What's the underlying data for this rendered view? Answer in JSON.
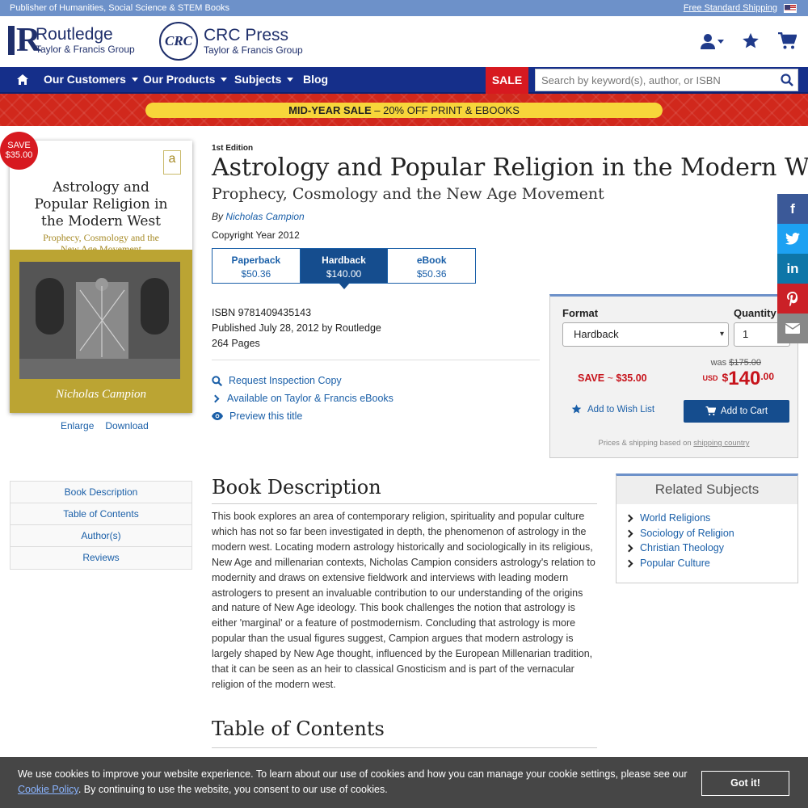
{
  "topbar": {
    "tagline": "Publisher of Humanities, Social Science & STEM Books",
    "shipping_link": "Free Standard Shipping",
    "flag_icon": "us-flag-icon"
  },
  "logos": {
    "routledge": {
      "name": "Routledge",
      "group": "Taylor & Francis Group"
    },
    "crc": {
      "mark": "CRC",
      "name": "CRC Press",
      "group": "Taylor & Francis Group"
    }
  },
  "header_icons": [
    "user-icon",
    "star-icon",
    "cart-icon"
  ],
  "nav": {
    "home_icon": "home-icon",
    "items": [
      "Our Customers",
      "Our Products",
      "Subjects",
      "Blog"
    ],
    "sale": "SALE",
    "search_placeholder": "Search by keyword(s), author, or ISBN"
  },
  "promo": {
    "bold": "MID-YEAR SALE",
    "rest": " – 20% OFF PRINT & EBOOKS"
  },
  "cover": {
    "title": "Astrology and Popular Religion in the Modern West",
    "subtitle": "Prophecy, Cosmology and the New Age Movement",
    "author": "Nicholas Campion",
    "badge_line1": "SAVE",
    "badge_line2": "$35.00",
    "enlarge": "Enlarge",
    "download": "Download"
  },
  "book": {
    "edition": "1st Edition",
    "title": "Astrology and Popular Religion in the Modern West",
    "subtitle": "Prophecy, Cosmology and the New Age Movement",
    "by": "By ",
    "author": "Nicholas Campion",
    "copyright": "Copyright Year 2012",
    "formats": [
      {
        "name": "Paperback",
        "price": "$50.36"
      },
      {
        "name": "Hardback",
        "price": "$140.00"
      },
      {
        "name": "eBook",
        "price": "$50.36"
      }
    ],
    "isbn": "ISBN 9781409435143",
    "published": "Published July 28, 2012 by Routledge",
    "pages": "264 Pages",
    "actions": [
      {
        "label": "Request Inspection Copy",
        "icon": "search-icon"
      },
      {
        "label": "Available on Taylor & Francis eBooks",
        "icon": "chevron-right-icon"
      },
      {
        "label": "Preview this title",
        "icon": "eye-icon"
      }
    ]
  },
  "buybox": {
    "format_label": "Format",
    "quantity_label": "Quantity",
    "format_value": "Hardback",
    "quantity_value": "1",
    "was_label": "was ",
    "was_price": "$175.00",
    "save_label": "SAVE",
    "save_sep": " ~ ",
    "save_amount": "$35.00",
    "currency": "USD",
    "price_symbol": "$",
    "price_whole": "140",
    "price_cents": ".00",
    "wish_label": "Add to Wish List",
    "cart_label": "Add to Cart",
    "ship_note": "Prices & shipping based on ",
    "ship_link": "shipping country"
  },
  "social": [
    {
      "icon": "facebook-icon",
      "glyph": "f",
      "color": "#3b5998"
    },
    {
      "icon": "twitter-icon",
      "glyph": "t",
      "color": "#1da1f2"
    },
    {
      "icon": "linkedin-icon",
      "glyph": "in",
      "color": "#0e76a8"
    },
    {
      "icon": "pinterest-icon",
      "glyph": "p",
      "color": "#cb2027"
    },
    {
      "icon": "email-icon",
      "glyph": "✉",
      "color": "#888888"
    }
  ],
  "side_nav": [
    "Book Description",
    "Table of Contents",
    "Author(s)",
    "Reviews"
  ],
  "description": {
    "heading": "Book Description",
    "text": "This book explores an area of contemporary religion, spirituality and popular culture which has not so far been investigated in depth, the phenomenon of astrology in the modern west. Locating modern astrology historically and sociologically in its religious, New Age and millenarian contexts, Nicholas Campion considers astrology's relation to modernity and draws on extensive fieldwork and interviews with leading modern astrologers to present an invaluable contribution to our understanding of the origins and nature of New Age ideology. This book challenges the notion that astrology is either 'marginal' or a feature of postmodernism. Concluding that astrology is more popular than the usual figures suggest, Campion argues that modern astrology is largely shaped by New Age thought, influenced by the European Millenarian tradition, that it can be seen as an heir to classical Gnosticism and is part of the vernacular religion of the modern west."
  },
  "toc": {
    "heading": "Table of Contents"
  },
  "related": {
    "heading": "Related Subjects",
    "items": [
      "World Religions",
      "Sociology of Religion",
      "Christian Theology",
      "Popular Culture"
    ]
  },
  "cookie": {
    "text1": "We use cookies to improve your website experience. To learn about our use of cookies and how you can manage your cookie settings, please see our ",
    "link": "Cookie Policy",
    "text2": ". By continuing to use the website, you consent to our use of cookies.",
    "button": "Got it!"
  }
}
